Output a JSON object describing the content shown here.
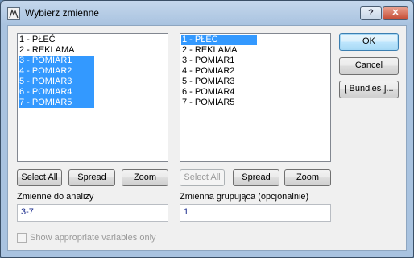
{
  "window": {
    "title": "Wybierz zmienne",
    "help_glyph": "?",
    "close_glyph": "✕"
  },
  "left_list": {
    "items": [
      {
        "label": "1 - PŁEĆ",
        "selected": false
      },
      {
        "label": "2 - REKLAMA",
        "selected": false
      },
      {
        "label": "3 - POMIAR1",
        "selected": true
      },
      {
        "label": "4 - POMIAR2",
        "selected": true
      },
      {
        "label": "5 - POMIAR3",
        "selected": true
      },
      {
        "label": "6 - POMIAR4",
        "selected": true
      },
      {
        "label": "7 - POMIAR5",
        "selected": true
      }
    ]
  },
  "right_list": {
    "items": [
      {
        "label": "1 - PŁEĆ",
        "selected": true
      },
      {
        "label": "2 - REKLAMA",
        "selected": false
      },
      {
        "label": "3 - POMIAR1",
        "selected": false
      },
      {
        "label": "4 - POMIAR2",
        "selected": false
      },
      {
        "label": "5 - POMIAR3",
        "selected": false
      },
      {
        "label": "6 - POMIAR4",
        "selected": false
      },
      {
        "label": "7 - POMIAR5",
        "selected": false
      }
    ]
  },
  "left_buttons": {
    "select_all": "Select All",
    "spread": "Spread",
    "zoom": "Zoom"
  },
  "right_buttons": {
    "select_all": "Select All",
    "spread": "Spread",
    "zoom": "Zoom"
  },
  "side_buttons": {
    "ok": "OK",
    "cancel": "Cancel",
    "bundles": "[ Bundles ]..."
  },
  "analysis": {
    "label": "Zmienne do analizy",
    "value": "3-7"
  },
  "grouping": {
    "label": "Zmienna grupująca (opcjonalnie)",
    "value": "1"
  },
  "show_appropriate": {
    "label": "Show appropriate variables only",
    "checked": false,
    "enabled": false
  },
  "colors": {
    "selection": "#3399ff",
    "field_text": "#1a2b8c",
    "title_bar": "#a9c3e0"
  }
}
